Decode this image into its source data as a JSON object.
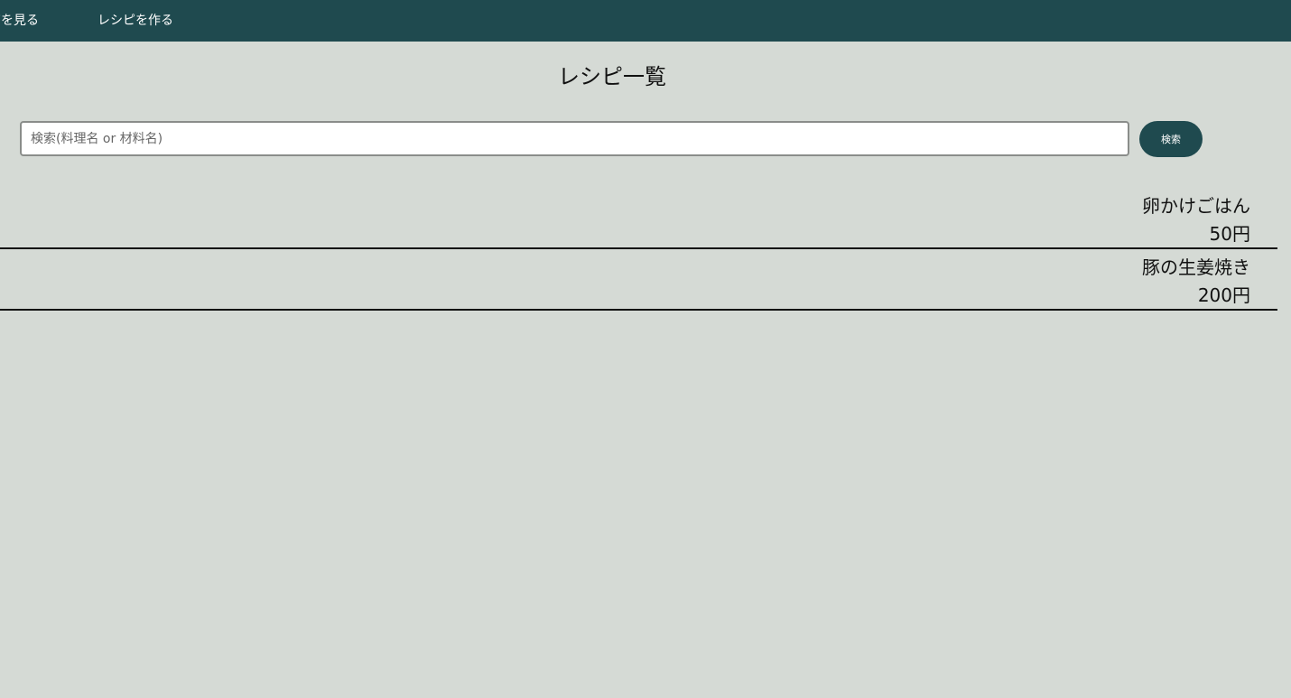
{
  "nav": {
    "view_recipes_label": "ピを見る",
    "create_recipe_label": "レシピを作る"
  },
  "page": {
    "title": "レシピ一覧"
  },
  "search": {
    "placeholder": "検索(料理名 or 材料名)",
    "value": "",
    "button_label": "検索"
  },
  "recipes": [
    {
      "name": "卵かけごはん",
      "price": "50円"
    },
    {
      "name": "豚の生姜焼き",
      "price": "200円"
    }
  ],
  "colors": {
    "accent": "#1f4a4f",
    "background": "#d5dad5"
  }
}
